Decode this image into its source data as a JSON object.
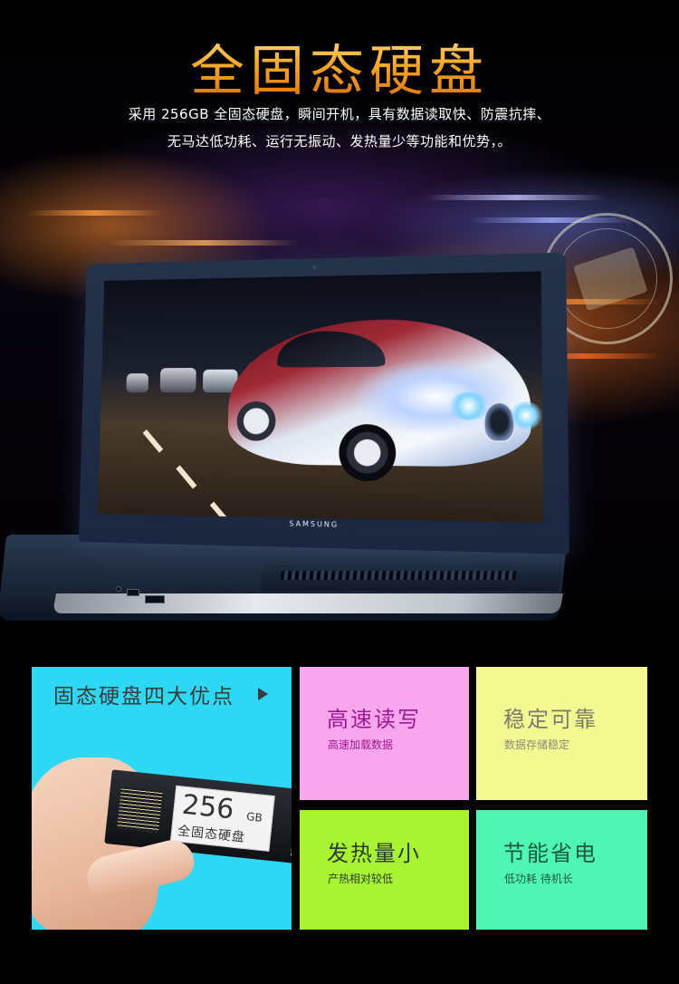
{
  "hero": {
    "title": "全固态硬盘",
    "subtitle_line1": "采用 256GB 全固态硬盘，瞬间开机，具有数据读取快、防震抗摔、",
    "subtitle_line2": "无马达低功耗、运行无振动、发热量少等功能和优势，。",
    "laptop_brand": "SAMSUNG"
  },
  "features": {
    "heading": "固态硬盘四大优点",
    "ssd_capacity": "256",
    "ssd_unit": "GB",
    "ssd_name": "全固态硬盘",
    "items": [
      {
        "title": "高速读写",
        "desc": "高速加载数据",
        "color": "#f8a6ee"
      },
      {
        "title": "稳定可靠",
        "desc": "数据存储稳定",
        "color": "#f1f990"
      },
      {
        "title": "发热量小",
        "desc": "产热相对较低",
        "color": "#a8f433"
      },
      {
        "title": "节能省电",
        "desc": "低功耗 待机长",
        "color": "#4ff6b2"
      }
    ]
  },
  "colors": {
    "title_gold": "#f5a623",
    "main_tile": "#2ed8f5"
  }
}
